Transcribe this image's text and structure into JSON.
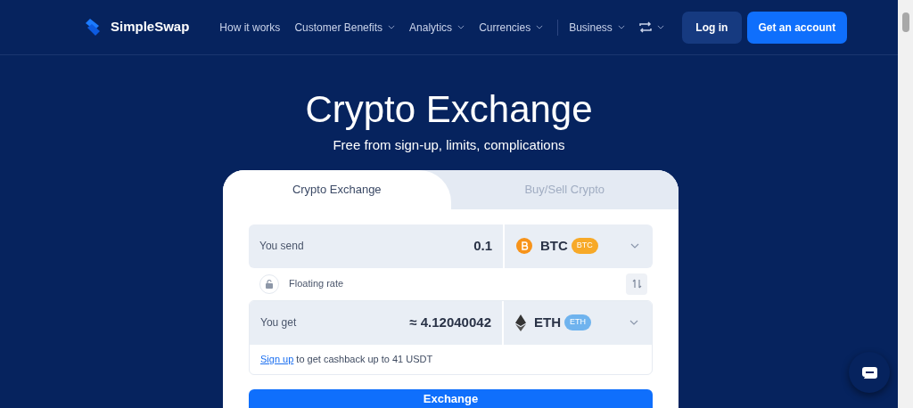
{
  "header": {
    "brand": "SimpleSwap",
    "nav": [
      {
        "label": "How it works",
        "dropdown": false
      },
      {
        "label": "Customer Benefits",
        "dropdown": true
      },
      {
        "label": "Analytics",
        "dropdown": true
      },
      {
        "label": "Currencies",
        "dropdown": true
      },
      {
        "label": "Business",
        "dropdown": true
      }
    ],
    "login": "Log in",
    "signup": "Get an account"
  },
  "hero": {
    "title": "Crypto Exchange",
    "subtitle": "Free from sign-up, limits, complications"
  },
  "tabs": [
    {
      "label": "Crypto Exchange",
      "selected": true
    },
    {
      "label": "Buy/Sell Crypto",
      "selected": false
    }
  ],
  "send": {
    "label": "You send",
    "value": "0.1",
    "currency": "BTC",
    "badge": "BTC",
    "kind": "btc"
  },
  "rate": {
    "label": "Floating rate",
    "locked": false
  },
  "get": {
    "label": "You get",
    "value": "≈ 4.12040042",
    "currency": "ETH",
    "badge": "ETH",
    "kind": "eth"
  },
  "cashback": {
    "link": "Sign up",
    "text": "to get cashback up to 41 USDT"
  },
  "exchange_button": "Exchange"
}
